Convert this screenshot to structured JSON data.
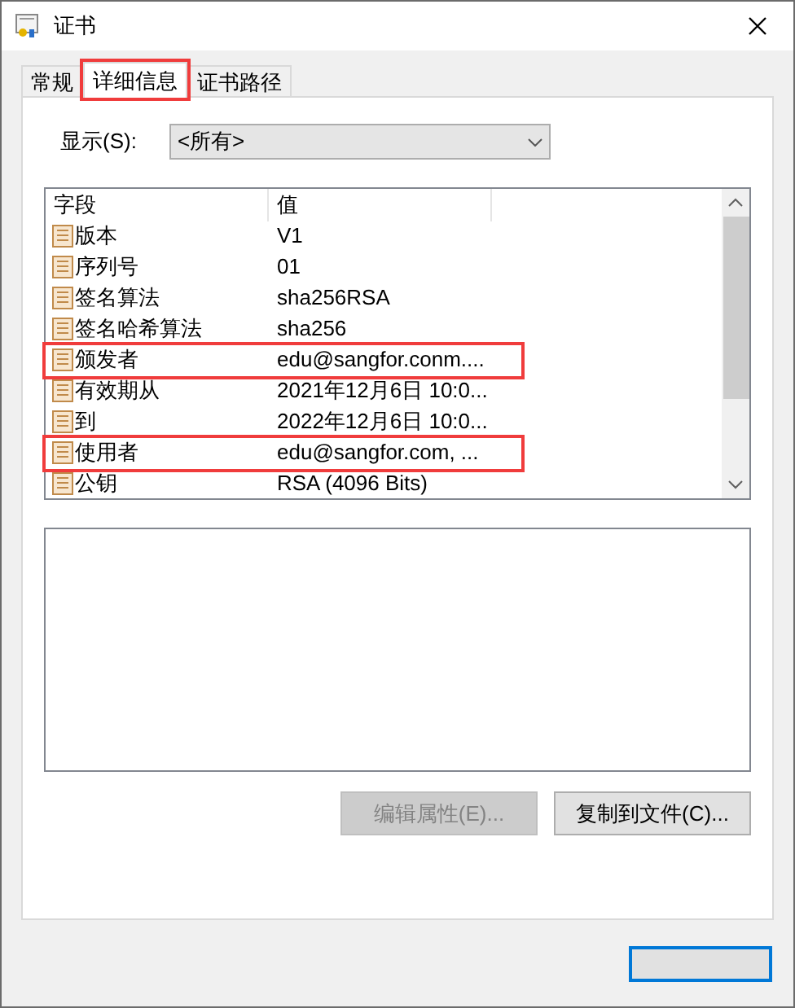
{
  "window": {
    "title": "证书"
  },
  "tabs": [
    {
      "label": "常规",
      "selected": false,
      "highlighted": false
    },
    {
      "label": "详细信息",
      "selected": true,
      "highlighted": true
    },
    {
      "label": "证书路径",
      "selected": false,
      "highlighted": false
    }
  ],
  "show": {
    "label": "显示(S):",
    "value": "<所有>"
  },
  "table": {
    "columns": [
      "字段",
      "值"
    ],
    "rows": [
      {
        "field": "版本",
        "value": "V1",
        "highlighted": false
      },
      {
        "field": "序列号",
        "value": "01",
        "highlighted": false
      },
      {
        "field": "签名算法",
        "value": "sha256RSA",
        "highlighted": false
      },
      {
        "field": "签名哈希算法",
        "value": "sha256",
        "highlighted": false
      },
      {
        "field": "颁发者",
        "value": "edu@sangfor.conm....",
        "highlighted": true
      },
      {
        "field": "有效期从",
        "value": "2021年12月6日 10:0...",
        "highlighted": false
      },
      {
        "field": "到",
        "value": "2022年12月6日 10:0...",
        "highlighted": false
      },
      {
        "field": "使用者",
        "value": "edu@sangfor.com, ...",
        "highlighted": true
      },
      {
        "field": "公钥",
        "value": "RSA (4096 Bits)",
        "highlighted": false
      }
    ]
  },
  "buttons": [
    {
      "label": "编辑属性(E)...",
      "disabled": true
    },
    {
      "label": "复制到文件(C)...",
      "disabled": false
    }
  ]
}
